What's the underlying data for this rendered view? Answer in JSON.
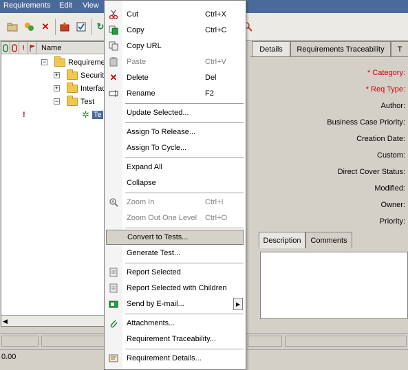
{
  "menubar": {
    "items": [
      "Requirements",
      "Edit",
      "View"
    ]
  },
  "tree": {
    "header_name": "Name",
    "nodes": [
      {
        "label": "Requirements",
        "expander": "−"
      },
      {
        "label": "Security",
        "expander": "+"
      },
      {
        "label": "Interface",
        "expander": "+"
      },
      {
        "label": "Test",
        "expander": "−"
      },
      {
        "label": "Te"
      }
    ],
    "flag_mark": "!"
  },
  "details_tabs": [
    "Details",
    "Requirements Traceability",
    "T"
  ],
  "details_fields": {
    "category": "* Category:",
    "req_type": "* Req Type:",
    "author": "Author:",
    "business_priority": "Business Case Priority:",
    "creation_date": "Creation Date:",
    "custom": "Custom:",
    "direct_cover_status": "Direct Cover Status:",
    "modified": "Modified:",
    "owner": "Owner:",
    "priority": "Priority:"
  },
  "desc_tabs": [
    "Description",
    "Comments"
  ],
  "status": {
    "value": "0.00"
  },
  "context_menu": {
    "items": [
      {
        "label": "Cut",
        "shortcut": "Ctrl+X",
        "icon": "scissors-icon"
      },
      {
        "label": "Copy",
        "shortcut": "Ctrl+C",
        "icon": "copy-icon"
      },
      {
        "label": "Copy URL",
        "shortcut": "",
        "icon": "copy-url-icon"
      },
      {
        "label": "Paste",
        "shortcut": "Ctrl+V",
        "icon": "paste-icon",
        "disabled": true
      },
      {
        "label": "Delete",
        "shortcut": "Del",
        "icon": "delete-icon"
      },
      {
        "label": "Rename",
        "shortcut": "F2",
        "icon": "rename-icon"
      },
      {
        "label": "Update Selected...",
        "shortcut": "",
        "icon": ""
      },
      {
        "label": "Assign To Release...",
        "shortcut": "",
        "icon": ""
      },
      {
        "label": "Assign To Cycle...",
        "shortcut": "",
        "icon": ""
      },
      {
        "label": "Expand All",
        "shortcut": "",
        "icon": ""
      },
      {
        "label": "Collapse",
        "shortcut": "",
        "icon": ""
      },
      {
        "label": "Zoom In",
        "shortcut": "Ctrl+I",
        "icon": "zoom-in-icon",
        "disabled": true
      },
      {
        "label": "Zoom Out One Level",
        "shortcut": "Ctrl+O",
        "icon": "",
        "disabled": true
      },
      {
        "label": "Convert to Tests...",
        "shortcut": "",
        "icon": "",
        "highlighted": true
      },
      {
        "label": "Generate Test...",
        "shortcut": "",
        "icon": ""
      },
      {
        "label": "Report Selected",
        "shortcut": "",
        "icon": "report-icon"
      },
      {
        "label": "Report Selected with Children",
        "shortcut": "",
        "icon": "report-children-icon"
      },
      {
        "label": "Send by E-mail...",
        "shortcut": "",
        "icon": "email-icon",
        "submenu": true
      },
      {
        "label": "Attachments...",
        "shortcut": "",
        "icon": "paperclip-icon"
      },
      {
        "label": "Requirement Traceability...",
        "shortcut": "",
        "icon": ""
      },
      {
        "label": "Requirement Details...",
        "shortcut": "",
        "icon": "details-icon"
      }
    ]
  },
  "colors": {
    "menubar_bg": "#4a6b9a",
    "required_label": "#d00000",
    "selection": "#4a6b9a"
  }
}
